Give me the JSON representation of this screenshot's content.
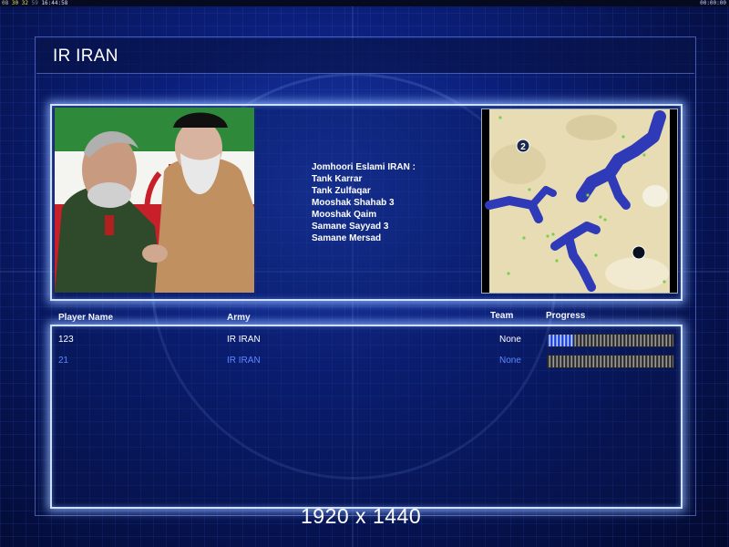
{
  "debug": {
    "left_a": "08",
    "left_b": "30",
    "left_c": "32",
    "left_d": "59",
    "left_e": "16:44:58",
    "right": "00:00:00"
  },
  "screen": {
    "title": "IR IRAN",
    "resolution_label": "1920 x 1440"
  },
  "army_units": {
    "faction_header": "Jomhoori Eslami IRAN :",
    "units": [
      "Tank Karrar",
      "Tank Zulfaqar",
      "Mooshak Shahab 3",
      "Mooshak Qaim",
      "Samane Sayyad 3",
      "Samane Mersad"
    ]
  },
  "minimap": {
    "start_positions": [
      "2",
      ""
    ],
    "colors": {
      "land": "#e8dcb4",
      "water": "#2f3ab8",
      "tree": "#7ad04a"
    }
  },
  "players_table": {
    "headers": {
      "player_name": "Player Name",
      "army": "Army",
      "team": "Team",
      "progress": "Progress"
    },
    "rows": [
      {
        "name": "123",
        "army": "IR IRAN",
        "team": "None",
        "progress": 0.2,
        "color": "#ffffff"
      },
      {
        "name": "21",
        "army": "IR IRAN",
        "team": "None",
        "progress": 0.0,
        "color": "#5d86ff"
      }
    ]
  },
  "colors": {
    "frame_glow": "#cfe0ff",
    "background": "#0b1f7a",
    "player2": "#5d86ff"
  }
}
